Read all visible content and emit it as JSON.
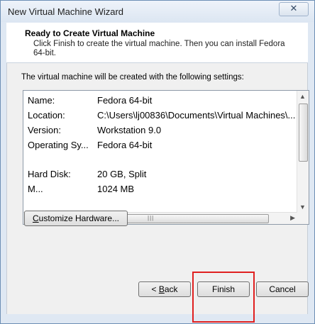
{
  "window": {
    "title": "New Virtual Machine Wizard",
    "close_glyph": "✕"
  },
  "header": {
    "title": "Ready to Create Virtual Machine",
    "description": "Click Finish to create the virtual machine. Then you can install Fedora 64-bit."
  },
  "content": {
    "intro": "The virtual machine will be created with the following settings:",
    "settings": [
      {
        "label": "Name:",
        "value": "Fedora 64-bit"
      },
      {
        "label": "Location:",
        "value": "C:\\Users\\lj00836\\Documents\\Virtual Machines\\..."
      },
      {
        "label": "Version:",
        "value": "Workstation 9.0"
      },
      {
        "label": "Operating Sy...",
        "value": "Fedora 64-bit"
      },
      {
        "label": "Hard Disk:",
        "value": "20 GB, Split"
      },
      {
        "label": "M...",
        "value": "1024 MB"
      }
    ],
    "customize_button": {
      "prefix": "",
      "mnemonic": "C",
      "rest": "ustomize Hardware..."
    }
  },
  "footer": {
    "back_button": {
      "prefix": "< ",
      "mnemonic": "B",
      "rest": "ack"
    },
    "finish_button": "Finish",
    "cancel_button": "Cancel"
  },
  "accent_colors": {
    "highlight": "#e02020",
    "title_bg": "#dce6f2"
  }
}
